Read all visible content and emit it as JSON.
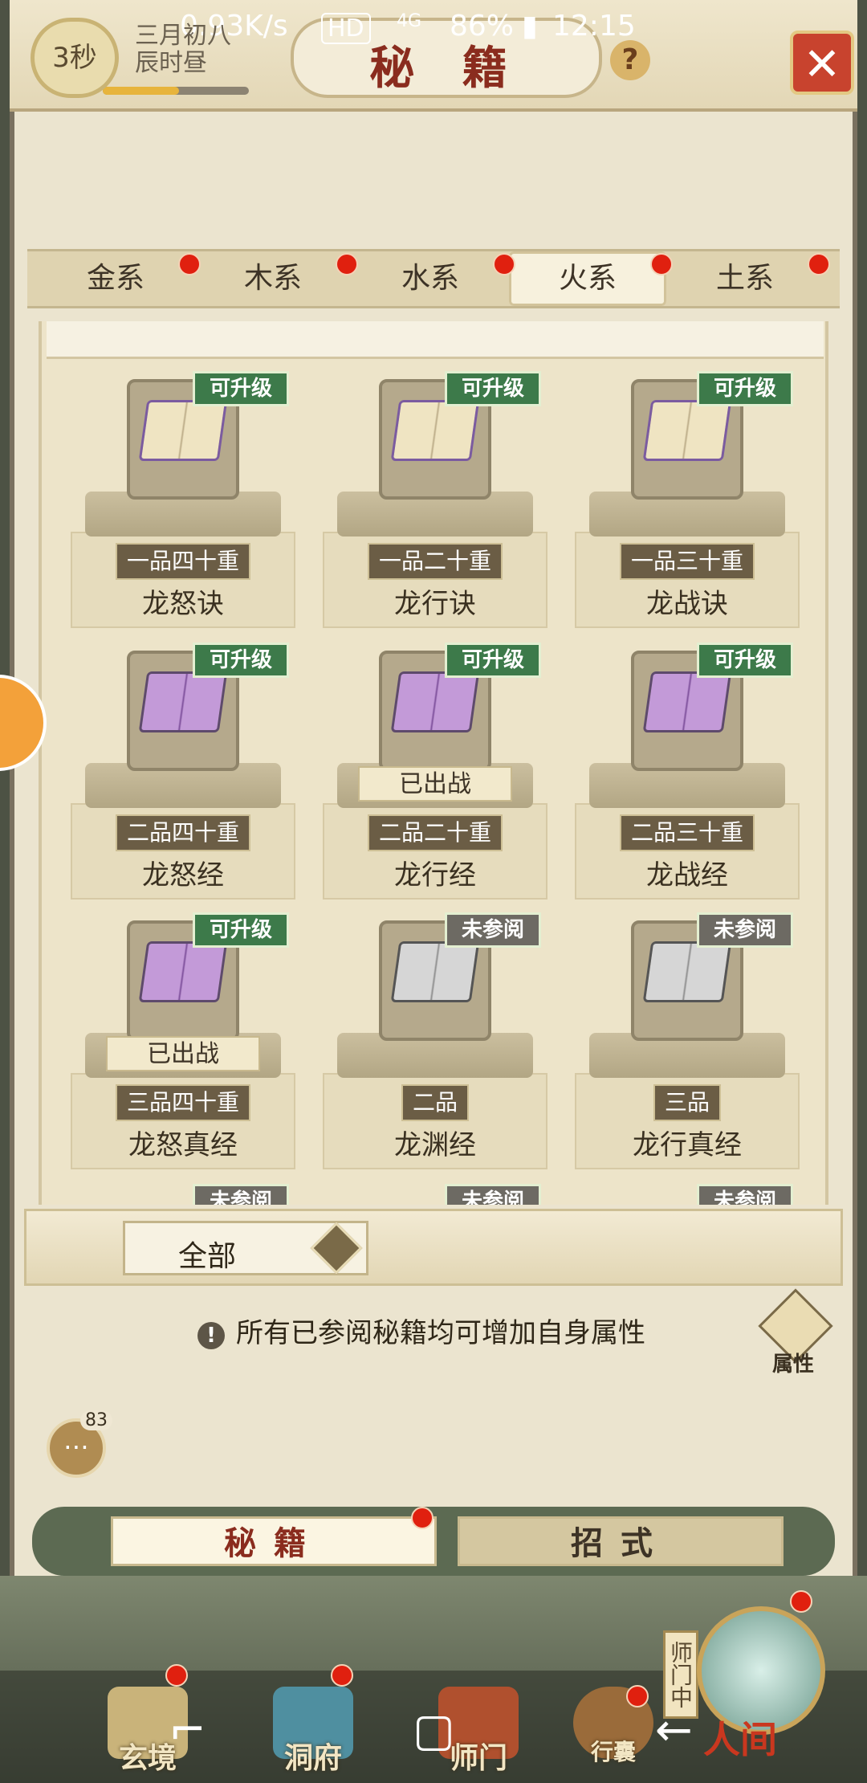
{
  "status_bar": {
    "speed": "0.93K/s",
    "hd": "HD",
    "signal": "4G",
    "battery": "86%",
    "time": "12:15"
  },
  "header": {
    "timer": "3秒",
    "lunar_date": "三月初八",
    "lunar_time": "辰时昼",
    "time_progress": 0.52,
    "title": "秘 籍",
    "help": "?",
    "close": "✕"
  },
  "element_tabs": [
    {
      "label": "金系",
      "active": false
    },
    {
      "label": "木系",
      "active": false
    },
    {
      "label": "水系",
      "active": false
    },
    {
      "label": "火系",
      "active": true
    },
    {
      "label": "土系",
      "active": false
    }
  ],
  "cards": [
    {
      "badge": "可升级",
      "grade": "一品四十重",
      "name": "龙怒诀",
      "deployed": "",
      "style": "yellow"
    },
    {
      "badge": "可升级",
      "grade": "一品二十重",
      "name": "龙行诀",
      "deployed": "",
      "style": "yellow"
    },
    {
      "badge": "可升级",
      "grade": "一品三十重",
      "name": "龙战诀",
      "deployed": "",
      "style": "yellow"
    },
    {
      "badge": "可升级",
      "grade": "二品四十重",
      "name": "龙怒经",
      "deployed": "",
      "style": "purple"
    },
    {
      "badge": "可升级",
      "grade": "二品二十重",
      "name": "龙行经",
      "deployed": "已出战",
      "style": "purple"
    },
    {
      "badge": "可升级",
      "grade": "二品三十重",
      "name": "龙战经",
      "deployed": "",
      "style": "purple"
    },
    {
      "badge": "可升级",
      "grade": "三品四十重",
      "name": "龙怒真经",
      "deployed": "已出战",
      "style": "purple"
    },
    {
      "badge": "未参阅",
      "grade": "二品",
      "name": "龙渊经",
      "deployed": "",
      "style": "gray"
    },
    {
      "badge": "未参阅",
      "grade": "三品",
      "name": "龙行真经",
      "deployed": "",
      "style": "gray"
    }
  ],
  "partial_row_badges": [
    "未参阅",
    "未参阅",
    "未参阅"
  ],
  "filter": {
    "selected": "全部"
  },
  "info_text": "所有已参阅秘籍均可增加自身属性",
  "attr_button": "属性",
  "chat": {
    "count": "83"
  },
  "lower_tabs": [
    {
      "label": "秘籍",
      "active": true
    },
    {
      "label": "招式",
      "active": false
    }
  ],
  "bottom_nav": [
    {
      "label": "玄境"
    },
    {
      "label": "洞府"
    },
    {
      "label": "师门"
    },
    {
      "label": "行囊"
    }
  ],
  "world_button": "人间",
  "shimen_side": "师门中"
}
